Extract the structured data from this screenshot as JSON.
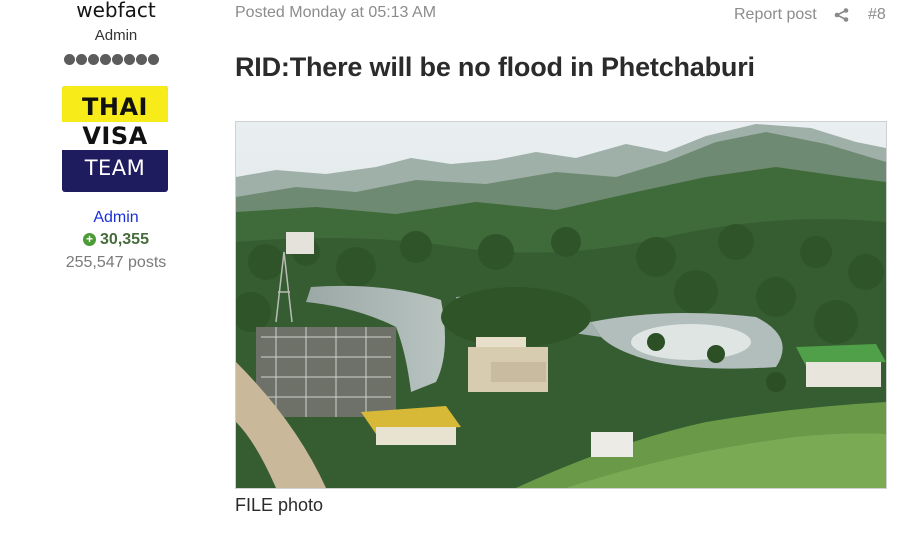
{
  "author": {
    "username": "webfact",
    "role": "Admin",
    "rank_dots": 8,
    "badge": {
      "line1": "THAI",
      "line2": "VISA",
      "line3": "TEAM"
    },
    "group_link": "Admin",
    "reputation": "30,355",
    "posts": "255,547 posts"
  },
  "post": {
    "posted": "Posted Monday at 05:13 AM",
    "report_label": "Report post",
    "share_icon": "share-icon",
    "number": "#8",
    "title": "RID:There will be no flood in Phetchaburi",
    "caption": "FILE photo"
  },
  "colors": {
    "admin_link": "#1a2fd6",
    "reputation": "#466b3c",
    "badge_yellow": "#f7ec1a",
    "badge_navy": "#1e1b5e",
    "muted_text": "#8c8c8c"
  }
}
